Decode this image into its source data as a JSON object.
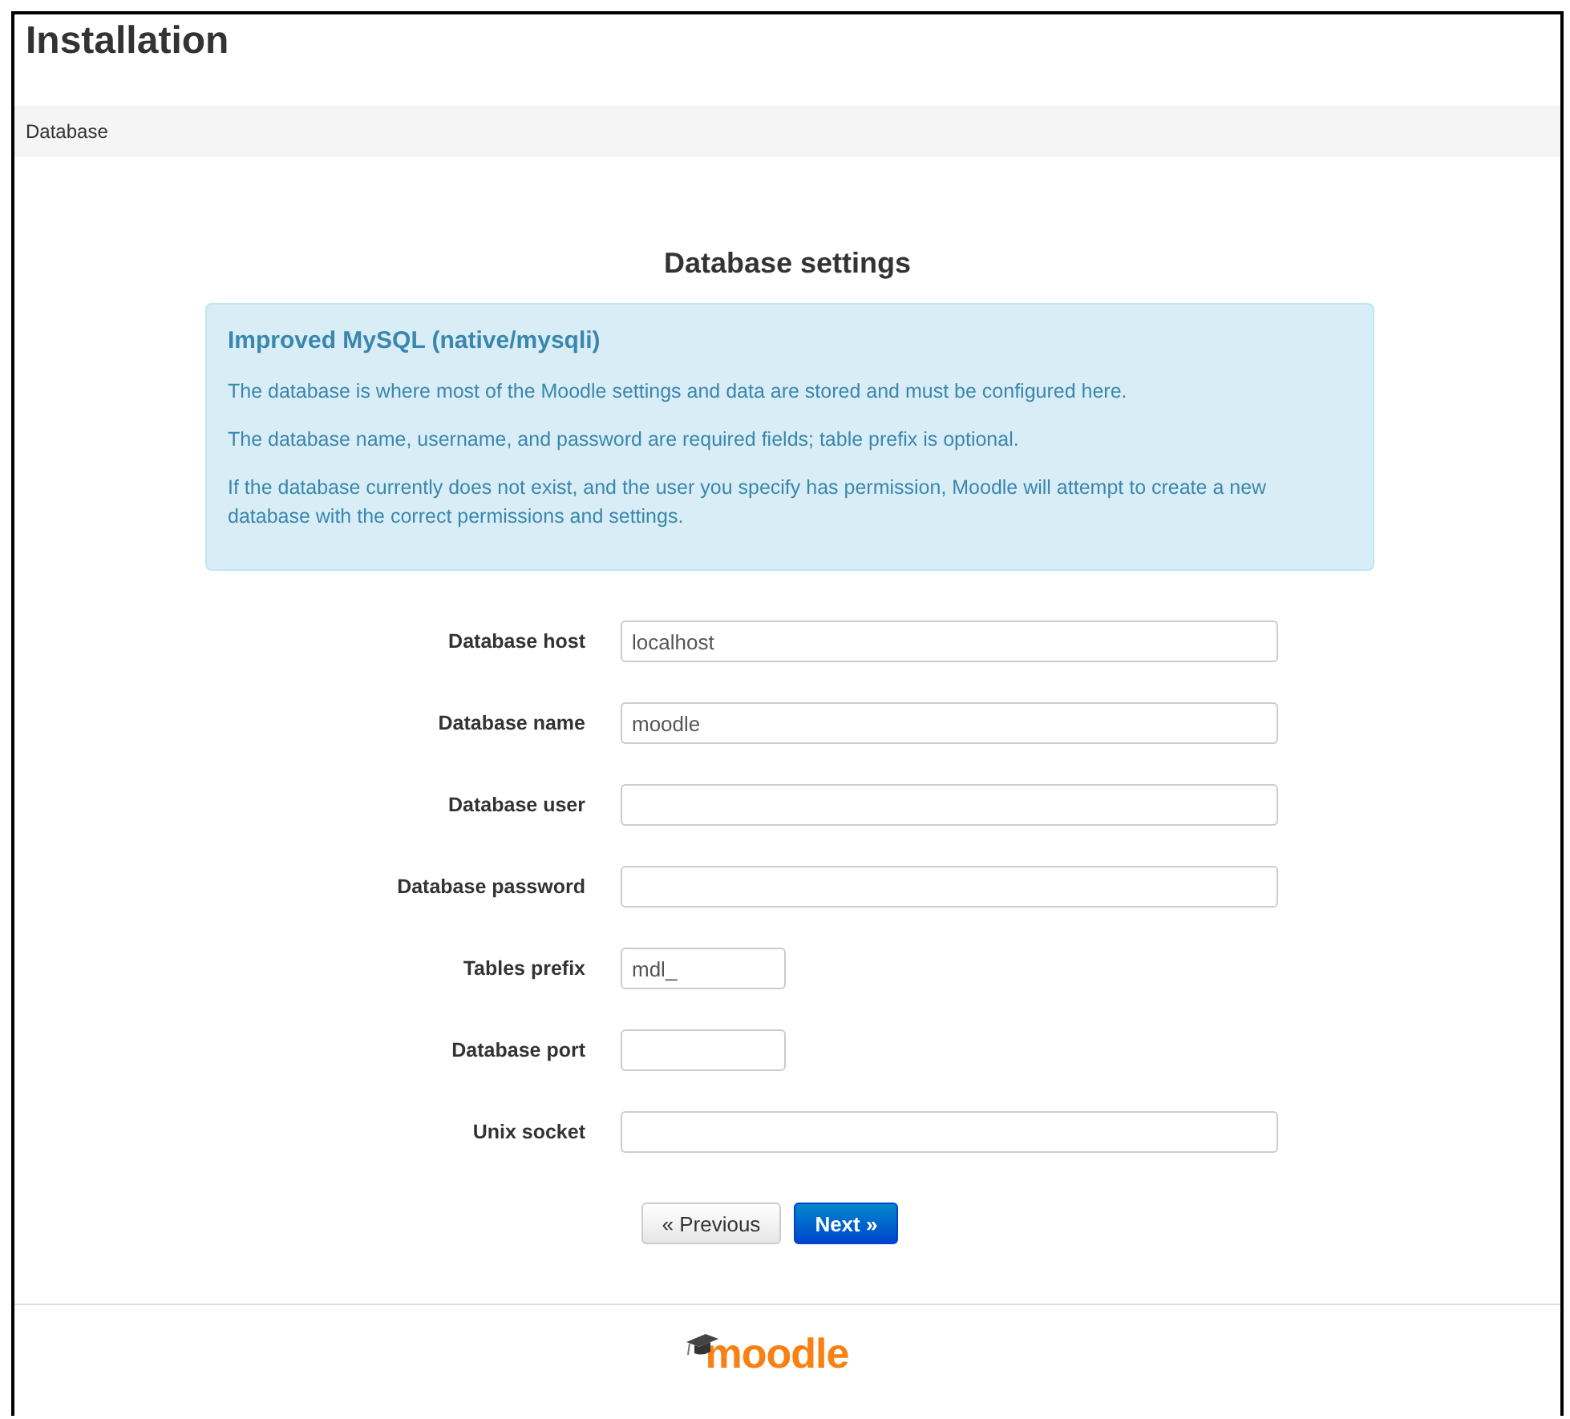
{
  "page_title": "Installation",
  "breadcrumb": "Database",
  "heading": "Database settings",
  "info": {
    "title": "Improved MySQL (native/mysqli)",
    "paragraphs": [
      "The database is where most of the Moodle settings and data are stored and must be configured here.",
      "The database name, username, and password are required fields; table prefix is optional.",
      "If the database currently does not exist, and the user you specify has permission, Moodle will attempt to create a new database with the correct permissions and settings."
    ]
  },
  "fields": [
    {
      "label": "Database host",
      "value": "localhost",
      "kind": "wide"
    },
    {
      "label": "Database name",
      "value": "moodle",
      "kind": "wide"
    },
    {
      "label": "Database user",
      "kind": "wide"
    },
    {
      "label": "Database password",
      "kind": "wide"
    },
    {
      "label": "Tables prefix",
      "value": "mdl_",
      "kind": "short"
    },
    {
      "label": "Database port",
      "kind": "short"
    },
    {
      "label": "Unix socket",
      "kind": "wide"
    }
  ],
  "buttons": [
    {
      "label": "« Previous",
      "kind": "default"
    },
    {
      "label": "Next »",
      "kind": "primary"
    }
  ],
  "footer_logo": "moodle"
}
